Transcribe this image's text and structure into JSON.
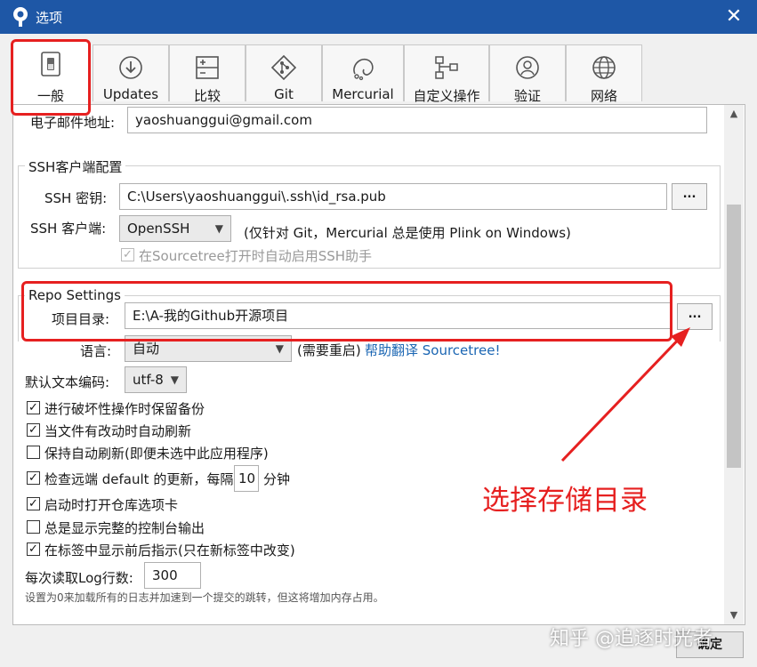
{
  "window": {
    "title": "选项",
    "close_glyph": "✕"
  },
  "tabs": [
    {
      "label": "一般",
      "icon": "switch-icon",
      "active": true
    },
    {
      "label": "Updates",
      "icon": "download-icon"
    },
    {
      "label": "比较",
      "icon": "compare-icon"
    },
    {
      "label": "Git",
      "icon": "git-icon"
    },
    {
      "label": "Mercurial",
      "icon": "mercurial-icon"
    },
    {
      "label": "自定义操作",
      "icon": "custom-actions-icon"
    },
    {
      "label": "验证",
      "icon": "user-icon"
    },
    {
      "label": "网络",
      "icon": "globe-icon"
    }
  ],
  "general": {
    "email_label": "电子邮件地址:",
    "email_value": "yaoshuanggui@gmail.com"
  },
  "ssh": {
    "group_title": "SSH客户端配置",
    "key_label": "SSH 密钥:",
    "key_value": "C:\\Users\\yaoshuanggui\\.ssh\\id_rsa.pub",
    "browse_label": "...",
    "client_label": "SSH 客户端:",
    "client_value": "OpenSSH",
    "client_note": "(仅针对 Git，Mercurial 总是使用 Plink on Windows)",
    "auto_start_label": "在Sourcetree打开时自动启用SSH助手",
    "auto_start_checked": true
  },
  "repo": {
    "group_title": "Repo Settings",
    "project_dir_label": "项目目录:",
    "project_dir_value": "E:\\A-我的Github开源项目",
    "browse_label": "...",
    "language_label": "语言:",
    "language_value": "自动",
    "restart_note": "(需要重启)",
    "translate_link": "帮助翻译 Sourcetree!",
    "encoding_label": "默认文本编码:",
    "encoding_value": "utf-8"
  },
  "options": [
    {
      "label": "进行破坏性操作时保留备份",
      "checked": true
    },
    {
      "label": "当文件有改动时自动刷新",
      "checked": true
    },
    {
      "label": "保持自动刷新(即便未选中此应用程序)",
      "checked": false
    },
    {
      "label": "检查远端 default 的更新，每隔",
      "checked": true
    },
    {
      "label": "启动时打开仓库选项卡",
      "checked": true
    },
    {
      "label": "总是显示完整的控制台输出",
      "checked": false
    },
    {
      "label": "在标签中显示前后指示(只在新标签中改变)",
      "checked": true
    }
  ],
  "remote_check": {
    "interval_value": "10",
    "unit_label": "分钟"
  },
  "log": {
    "label": "每次读取Log行数:",
    "value": "300",
    "hint": "设置为0来加载所有的日志并加速到一个提交的跳转，但这将增加内存占用。"
  },
  "footer": {
    "ok_label": "确定"
  },
  "annotation": {
    "text": "选择存储目录",
    "color": "#e62020"
  },
  "watermark": "知乎 @追逐时光者",
  "colors": {
    "titlebar": "#1e57a6",
    "annotation": "#e62020",
    "link": "#1b66b3"
  }
}
